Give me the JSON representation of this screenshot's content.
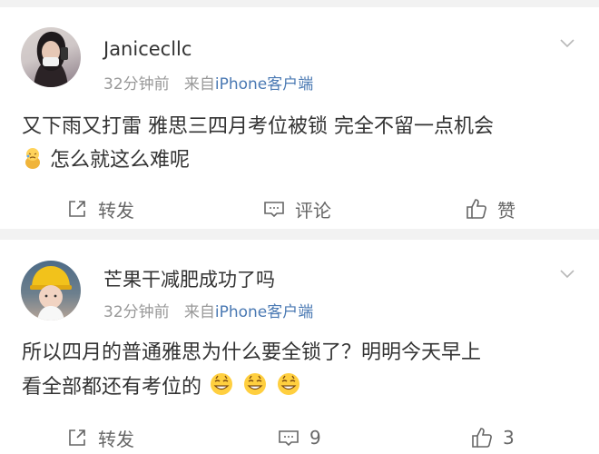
{
  "posts": [
    {
      "username": "Janicecllc",
      "time": "32分钟前",
      "source_prefix": "来自",
      "source": "iPhone客户端",
      "text_line1": "又下雨又打雷 雅思三四月考位被锁 完全不留一点机会",
      "text_line2": "怎么就这么难呢",
      "repost_label": "转发",
      "comment_label": "评论",
      "like_label": "赞"
    },
    {
      "username": "芒果干减肥成功了吗",
      "time": "32分钟前",
      "source_prefix": "来自",
      "source": "iPhone客户端",
      "text_line1": "所以四月的普通雅思为什么要全锁了？明明今天早上",
      "text_line2": "看全部都还有考位的",
      "repost_label": "转发",
      "comment_count": "9",
      "like_count": "3"
    }
  ],
  "colors": {
    "link": "#4a79b3",
    "meta": "#999999",
    "text": "#333333"
  },
  "icons": [
    "chevron-down-icon",
    "share-icon",
    "comment-icon",
    "thumbs-up-icon",
    "sad-emoji-icon",
    "grin-emoji-icon"
  ]
}
